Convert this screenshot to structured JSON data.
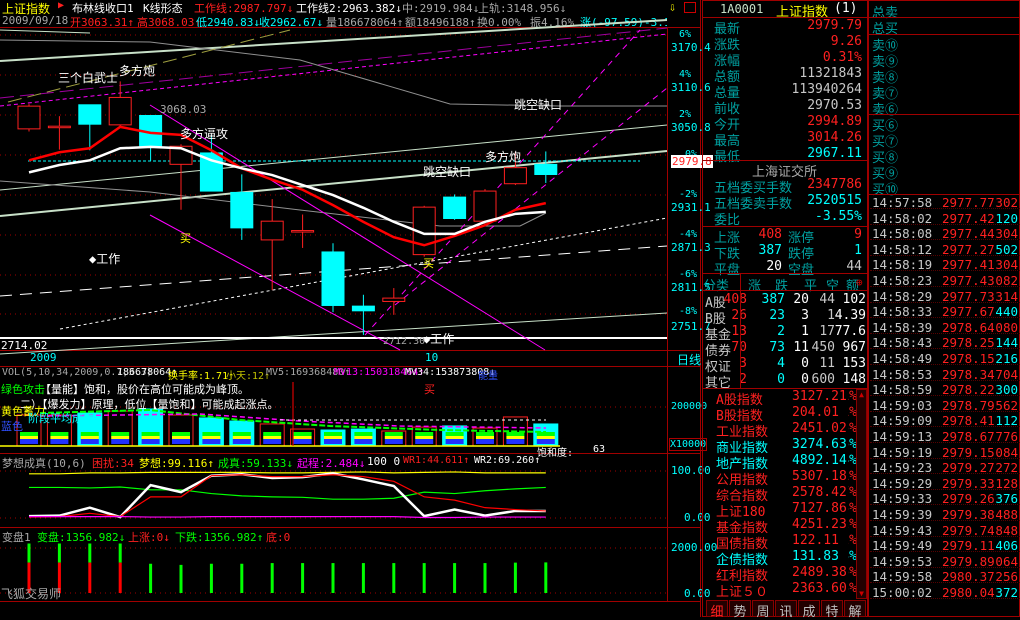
{
  "header": {
    "index_name": "上证指数",
    "pattern1": "布林线收口1",
    "pattern2": "K线形态",
    "work_line": "工作线:2987.797↓",
    "work_line2": "工作线2:2963.382↓",
    "mid": "中:2919.984↓",
    "upper": "上轨:3148.956↓",
    "date": "2009/09/18",
    "open": "开3063.31↑",
    "high": "高3068.03↑",
    "low": "低2940.83↓",
    "close": "收2962.67↓",
    "volume": "量186678064↑",
    "amount": "额18496188↑",
    "turnover": "换0.00%",
    "amplitude": "振4.16%",
    "change": "涨(-97.59)-3.19"
  },
  "main_chart": {
    "annotations": {
      "three_soldiers": "三个白武士",
      "bull_cannon1": "多方炮",
      "high_label": "3068.03",
      "attack": "多方逼攻",
      "gap1": "跳空缺口",
      "bull_cannon2": "多方炮",
      "gap2": "跳空缺口",
      "buy1": "买",
      "buy2": "买",
      "work1": "◆工作",
      "work2": "◆工作",
      "low_label": "2712.30",
      "bottom_left": "2714.02"
    },
    "axis_pct": [
      "6%",
      "4%",
      "2%",
      "0%",
      "-2%",
      "-4%",
      "-6%",
      "-8%"
    ],
    "axis_price": [
      "3170.4",
      "3110.6",
      "3050.8",
      "2931.1",
      "2871.3",
      "2811.5",
      "2751.7"
    ],
    "current_price": "2979.8",
    "x_labels": {
      "year": "2009",
      "month": "10",
      "period": "日线"
    },
    "price_range": [
      2700,
      3190
    ],
    "candles": [
      {
        "o": 3048,
        "h": 3085,
        "l": 3044,
        "c": 3082
      },
      {
        "o": 3050,
        "h": 3067,
        "l": 3017,
        "c": 3052
      },
      {
        "o": 3084,
        "h": 3084,
        "l": 3016,
        "c": 3055
      },
      {
        "o": 3054,
        "h": 3119,
        "l": 3050,
        "c": 3095
      },
      {
        "o": 3068,
        "h": 3068,
        "l": 3000,
        "c": 3021
      },
      {
        "o": 2995,
        "h": 3025,
        "l": 2927,
        "c": 3022
      },
      {
        "o": 3012,
        "h": 3039,
        "l": 2955,
        "c": 2955
      },
      {
        "o": 2953,
        "h": 2980,
        "l": 2882,
        "c": 2900
      },
      {
        "o": 2882,
        "h": 2943,
        "l": 2807,
        "c": 2910
      },
      {
        "o": 2894,
        "h": 2920,
        "l": 2870,
        "c": 2896
      },
      {
        "o": 2864,
        "h": 2877,
        "l": 2774,
        "c": 2784
      },
      {
        "o": 2783,
        "h": 2800,
        "l": 2740,
        "c": 2776
      },
      {
        "o": 2790,
        "h": 2810,
        "l": 2770,
        "c": 2795
      },
      {
        "o": 2860,
        "h": 2933,
        "l": 2857,
        "c": 2931
      },
      {
        "o": 2946,
        "h": 2950,
        "l": 2912,
        "c": 2914
      },
      {
        "o": 2910,
        "h": 2958,
        "l": 2905,
        "c": 2955
      },
      {
        "o": 2966,
        "h": 3014,
        "l": 2964,
        "c": 2990
      },
      {
        "o": 2994.89,
        "h": 3014.26,
        "l": 2967.11,
        "c": 2979.79
      }
    ],
    "ma_red": [
      3001,
      3013,
      3019,
      3051,
      3042,
      3039,
      3016,
      2989,
      2972,
      2957,
      2934,
      2909,
      2886,
      2874,
      2888,
      2904,
      2927,
      2937
    ],
    "ma_white": [
      2983,
      2994,
      3001,
      3019,
      3021,
      3019,
      3001,
      2989,
      2979,
      2964,
      2949,
      2930,
      2909,
      2891,
      2891,
      2909,
      2921,
      2924
    ]
  },
  "volume_panel": {
    "title": "VOL(5,10,34,2009,0.7,3.3)",
    "value": "186678064↑",
    "turnover": "换手率:1.71↑",
    "small": "小天:12↑",
    "mv5": "MV5:169368480↑",
    "mv13": "MV13:150318464↑",
    "mv34": "MV34:153873808↓",
    "energy": "能量",
    "note_green": "绿色攻击",
    "note1": "【量能】饱和，股价在高位可能成为峰顶。",
    "note2": "二）【爆发力】原理，低位【量饱和】可能成起涨点。",
    "note_yellow": "黄色蓄力",
    "note3": "阶段平均成本",
    "note_blue": "蓝色",
    "buy": "买",
    "saturation": "饱和度:",
    "saturation_value": "63",
    "axis_top": "200000",
    "axis_unit": "X10000",
    "range": [
      0,
      260000
    ],
    "volumes": [
      159000,
      159000,
      169000,
      179000,
      190000,
      159000,
      144000,
      128000,
      113000,
      87000,
      82000,
      87000,
      77000,
      97000,
      103000,
      92000,
      149000,
      113000
    ]
  },
  "dream_panel": {
    "title": "梦想成真(10,6)",
    "trouble": "困扰:34",
    "dream": "梦想:99.116↑",
    "success": "成真:59.133↓",
    "start": "起程:2.484↓",
    "fixed": "100 0",
    "wr1": "WR1:44.611↑",
    "wr2": "WR2:69.260↑",
    "axis_top": "100.00",
    "axis_bottom": "0.00",
    "series": {
      "yellow": [
        94,
        94,
        96,
        96,
        97,
        97,
        97,
        97,
        96,
        96,
        97,
        98,
        96,
        97,
        98,
        96,
        96,
        96
      ],
      "green": [
        65,
        65,
        64,
        66,
        60,
        60,
        52,
        47,
        45,
        44,
        40,
        40,
        42,
        55,
        52,
        58,
        62,
        65
      ],
      "white": [
        4,
        5,
        22,
        2,
        70,
        55,
        90,
        93,
        85,
        87,
        95,
        82,
        68,
        4,
        18,
        5,
        15,
        15
      ],
      "red": [
        2,
        3,
        10,
        3,
        45,
        45,
        90,
        92,
        88,
        88,
        92,
        88,
        78,
        45,
        38,
        22,
        18,
        15
      ],
      "magenta": [
        3,
        3,
        3,
        3,
        2,
        2,
        3,
        3,
        3,
        3,
        3,
        3,
        3,
        1,
        1,
        2,
        2,
        2
      ]
    }
  },
  "change_panel": {
    "title": "变盘1",
    "change": "变盘:1356.982↓",
    "up": "上涨:0↓",
    "down": "下跌:1356.982↑",
    "bottom": "底:0",
    "axis_top": "2000.00",
    "axis_bottom": "0.00",
    "watermark": "飞狐交易师",
    "totals": [
      2200,
      2200,
      2200,
      2200,
      1300,
      1250,
      1300,
      1300,
      1330,
      1330,
      1330,
      1330,
      1330,
      1330,
      1330,
      1330,
      1350,
      1360
    ],
    "red_parts": [
      1350,
      1350,
      1350,
      1350,
      0,
      0,
      0,
      0,
      0,
      0,
      0,
      0,
      0,
      0,
      0,
      0,
      0,
      0
    ]
  },
  "quote": {
    "code": "1A0001",
    "name": "上证指数",
    "suffix": "(1)",
    "rows": [
      {
        "label": "最新",
        "value": "2979.79",
        "color": "#ff2020"
      },
      {
        "label": "涨跌",
        "value": "9.26",
        "color": "#ff2020"
      },
      {
        "label": "涨幅",
        "value": "0.31%",
        "color": "#ff2020"
      },
      {
        "label": "总额",
        "value": "11321843",
        "color": "#c8c8c8"
      },
      {
        "label": "总量",
        "value": "113940264",
        "color": "#c8c8c8"
      },
      {
        "label": "前收",
        "value": "2970.53",
        "color": "#c8c8c8"
      },
      {
        "label": "今开",
        "value": "2994.89",
        "color": "#ff2020"
      },
      {
        "label": "最高",
        "value": "3014.26",
        "color": "#ff2020"
      },
      {
        "label": "最低",
        "value": "2967.11",
        "color": "#00ffff"
      }
    ],
    "exchange": "上海证交所",
    "buy_orders_label": "五档委买手数",
    "buy_orders": "2347786",
    "sell_orders_label": "五档委卖手数",
    "sell_orders": "2520515",
    "ratio_label": "委比",
    "ratio": "-3.55%",
    "breadth": [
      {
        "l1": "上涨",
        "v1": "408",
        "c1": "#ff2020",
        "l2": "涨停",
        "v2": "9",
        "c2": "#ff2020"
      },
      {
        "l1": "下跌",
        "v1": "387",
        "c1": "#00ffff",
        "l2": "跌停",
        "v2": "1",
        "c2": "#00ffff"
      },
      {
        "l1": "平盘",
        "v1": "20",
        "c1": "#fff",
        "l2": "空盘",
        "v2": "44",
        "c2": "#c8c8c8"
      }
    ],
    "class_headers": [
      "分类",
      "涨",
      "跌",
      "平",
      "空",
      "额"
    ],
    "classes": [
      {
        "name": "A股",
        "up": "408",
        "down": "387",
        "flat": "20",
        "empty": "44",
        "amt": "102"
      },
      {
        "name": "B股",
        "up": "26",
        "down": "23",
        "flat": "3",
        "empty": "1",
        "amt": "4.39"
      },
      {
        "name": "基金",
        "up": "13",
        "down": "2",
        "flat": "1",
        "empty": "17",
        "amt": "77.6"
      },
      {
        "name": "债券",
        "up": "70",
        "down": "73",
        "flat": "11",
        "empty": "450",
        "amt": "967"
      },
      {
        "name": "权证",
        "up": "3",
        "down": "4",
        "flat": "0",
        "empty": "11",
        "amt": "153"
      },
      {
        "name": "其它",
        "up": "2",
        "down": "0",
        "flat": "0",
        "empty": "600",
        "amt": "148"
      }
    ],
    "indices": [
      {
        "name": "A股指数",
        "value": "3127.21",
        "pct": "1%",
        "color": "#ff2020"
      },
      {
        "name": "B股指数",
        "value": "204.01",
        "pct": "1%",
        "color": "#ff2020"
      },
      {
        "name": "工业指数",
        "value": "2451.02",
        "pct": "5%",
        "color": "#ff2020"
      },
      {
        "name": "商业指数",
        "value": "3274.63",
        "pct": "5%",
        "color": "#00ffff"
      },
      {
        "name": "地产指数",
        "value": "4892.14",
        "pct": "4%",
        "color": "#00ffff"
      },
      {
        "name": "公用指数",
        "value": "5307.18",
        "pct": "1%",
        "color": "#ff2020"
      },
      {
        "name": "综合指数",
        "value": "2578.42",
        "pct": "7%",
        "color": "#ff2020"
      },
      {
        "name": "上证180",
        "value": "7127.86",
        "pct": "3%",
        "color": "#ff2020"
      },
      {
        "name": "基金指数",
        "value": "4251.23",
        "pct": "2%",
        "color": "#ff2020"
      },
      {
        "name": "国债指数",
        "value": "122.11",
        "pct": "2%",
        "color": "#ff2020"
      },
      {
        "name": "企债指数",
        "value": "131.83",
        "pct": "3%",
        "color": "#00ffff"
      },
      {
        "name": "红利指数",
        "value": "2489.38",
        "pct": "5%",
        "color": "#ff2020"
      },
      {
        "name": "上证５０",
        "value": "2363.60",
        "pct": "3%",
        "color": "#ff2020"
      }
    ],
    "tabs": [
      "细",
      "势",
      "周",
      "讯",
      "成",
      "特",
      "解"
    ]
  },
  "order_book": {
    "total_sell": "总卖",
    "total_buy": "总买",
    "sells": [
      "卖⑩",
      "卖⑨",
      "卖⑧",
      "卖⑦",
      "卖⑥"
    ],
    "buys": [
      "买⑥",
      "买⑦",
      "买⑧",
      "买⑨",
      "买⑩"
    ]
  },
  "ticks": [
    {
      "t": "14:57:58",
      "p": "2977.77",
      "q": "302",
      "c": "#ff2020"
    },
    {
      "t": "14:58:02",
      "p": "2977.42",
      "q": "120",
      "c": "#00ffff"
    },
    {
      "t": "14:58:08",
      "p": "2977.44",
      "q": "304",
      "c": "#ff2020"
    },
    {
      "t": "14:58:12",
      "p": "2977.27",
      "q": "502",
      "c": "#00ffff"
    },
    {
      "t": "14:58:19",
      "p": "2977.41",
      "q": "304",
      "c": "#ff2020"
    },
    {
      "t": "14:58:23",
      "p": "2977.43",
      "q": "082",
      "c": "#ff2020"
    },
    {
      "t": "14:58:29",
      "p": "2977.73",
      "q": "314",
      "c": "#ff2020"
    },
    {
      "t": "14:58:33",
      "p": "2977.67",
      "q": "440",
      "c": "#00ffff"
    },
    {
      "t": "14:58:39",
      "p": "2978.64",
      "q": "080",
      "c": "#ff2020"
    },
    {
      "t": "14:58:43",
      "p": "2978.25",
      "q": "144",
      "c": "#00ffff"
    },
    {
      "t": "14:58:49",
      "p": "2978.15",
      "q": "216",
      "c": "#00ffff"
    },
    {
      "t": "14:58:53",
      "p": "2978.34",
      "q": "704",
      "c": "#ff2020"
    },
    {
      "t": "14:58:59",
      "p": "2978.22",
      "q": "300",
      "c": "#00ffff"
    },
    {
      "t": "14:59:03",
      "p": "2978.79",
      "q": "562",
      "c": "#ff2020"
    },
    {
      "t": "14:59:09",
      "p": "2978.41",
      "q": "112",
      "c": "#00ffff"
    },
    {
      "t": "14:59:13",
      "p": "2978.67",
      "q": "776",
      "c": "#ff2020"
    },
    {
      "t": "14:59:19",
      "p": "2979.15",
      "q": "084",
      "c": "#ff2020"
    },
    {
      "t": "14:59:23",
      "p": "2979.27",
      "q": "272",
      "c": "#ff2020"
    },
    {
      "t": "14:59:29",
      "p": "2979.33",
      "q": "128",
      "c": "#ff2020"
    },
    {
      "t": "14:59:33",
      "p": "2979.26",
      "q": "376",
      "c": "#00ffff"
    },
    {
      "t": "14:59:39",
      "p": "2979.38",
      "q": "488",
      "c": "#ff2020"
    },
    {
      "t": "14:59:43",
      "p": "2979.74",
      "q": "848",
      "c": "#ff2020"
    },
    {
      "t": "14:59:49",
      "p": "2979.11",
      "q": "406",
      "c": "#00ffff"
    },
    {
      "t": "14:59:53",
      "p": "2979.89",
      "q": "064",
      "c": "#ff2020"
    },
    {
      "t": "14:59:58",
      "p": "2980.37",
      "q": "256",
      "c": "#ff2020"
    },
    {
      "t": "15:00:02",
      "p": "2980.04",
      "q": "372",
      "c": "#00ffff"
    }
  ]
}
